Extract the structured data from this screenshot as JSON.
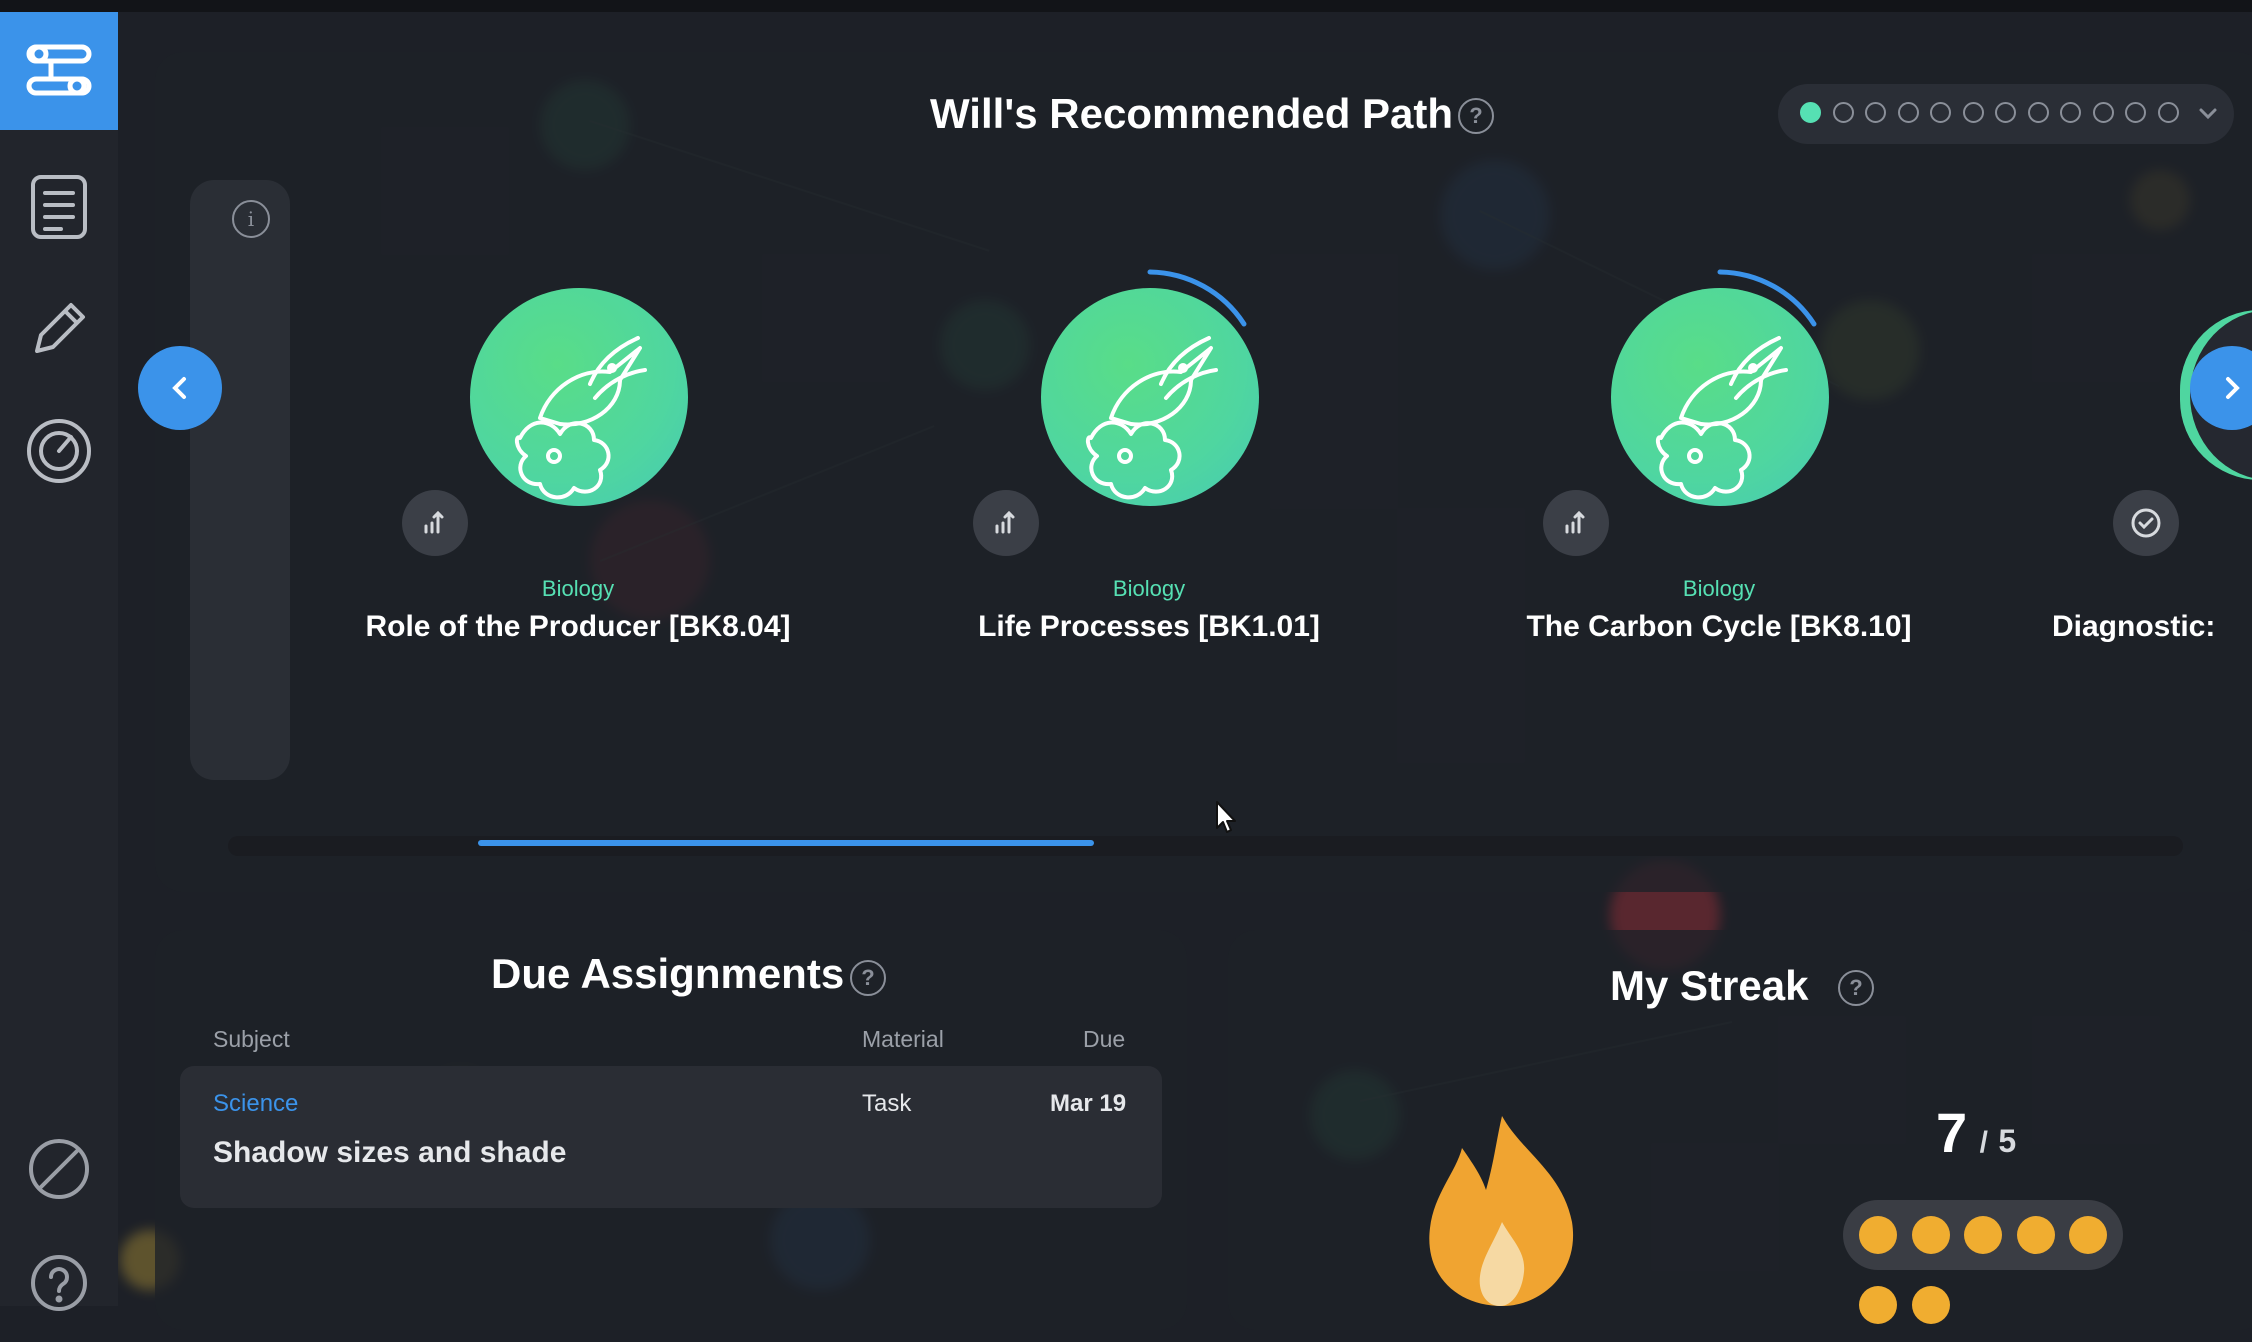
{
  "app": {
    "sidebar": {
      "items": [
        {
          "name": "learning-path",
          "icon": "path-nodes-icon",
          "active": true
        },
        {
          "name": "assignments",
          "icon": "list-icon",
          "active": false
        },
        {
          "name": "practice",
          "icon": "pencil-icon",
          "active": false
        },
        {
          "name": "progress",
          "icon": "gauge-icon",
          "active": false
        }
      ],
      "bottom_items": [
        {
          "name": "slash",
          "icon": "slash-circle-icon"
        },
        {
          "name": "help",
          "icon": "help-icon"
        }
      ]
    }
  },
  "path": {
    "title": "Will's Recommended Path",
    "help_label": "?",
    "info_label": "i",
    "pager": {
      "total": 12,
      "active_index": 0
    },
    "nodes": [
      {
        "subject": "Biology",
        "title": "Role of the Producer [BK8.04]",
        "status_icon": "stats-icon",
        "progress": 0
      },
      {
        "subject": "Biology",
        "title": "Life Processes [BK1.01]",
        "status_icon": "stats-icon",
        "progress": 0.12
      },
      {
        "subject": "Biology",
        "title": "The Carbon Cycle [BK8.10]",
        "status_icon": "stats-icon",
        "progress": 0.12
      },
      {
        "subject": "",
        "title": "Diagnostic:",
        "status_icon": "check-circle-icon",
        "progress": 0
      }
    ],
    "scroll_fraction": 0.32
  },
  "due": {
    "title": "Due Assignments",
    "help_label": "?",
    "columns": {
      "subject": "Subject",
      "material": "Material",
      "due": "Due"
    },
    "rows": [
      {
        "subject": "Science",
        "material": "Task",
        "due": "Mar 19",
        "title": "Shadow sizes and shade"
      }
    ]
  },
  "streak": {
    "title": "My Streak",
    "help_label": "?",
    "current": "7",
    "separator": "/",
    "goal": "5",
    "coins_row1": 5,
    "coins_row2_visible": 2
  },
  "colors": {
    "accent_blue": "#3b93ea",
    "mint": "#56e0b3",
    "coin": "#f0ad30",
    "background": "#1d2027"
  }
}
